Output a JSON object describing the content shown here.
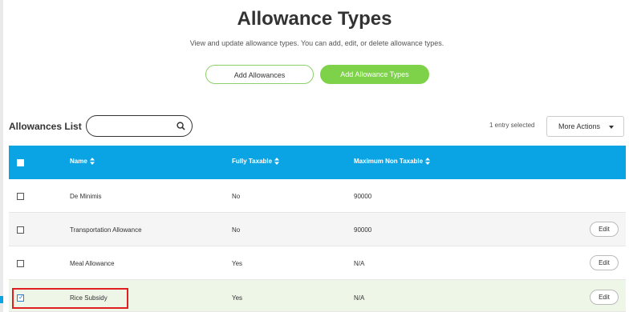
{
  "header": {
    "title": "Allowance Types",
    "subtitle": "View and update allowance types. You can add, edit, or delete allowance types."
  },
  "actions": {
    "add_allowances_label": "Add Allowances",
    "add_allowance_types_label": "Add Allowance Types"
  },
  "list": {
    "title": "Allowances List",
    "search_placeholder": "",
    "selected_count_text": "1 entry selected",
    "more_actions_label": "More Actions"
  },
  "table": {
    "columns": [
      "Name",
      "Fully Taxable",
      "Maximum Non Taxable"
    ],
    "rows": [
      {
        "name": "De Minimis",
        "fully_taxable": "No",
        "max_non_taxable": "90000",
        "checked": false,
        "edit_label": ""
      },
      {
        "name": "Transportation Allowance",
        "fully_taxable": "No",
        "max_non_taxable": "90000",
        "checked": false,
        "edit_label": "Edit"
      },
      {
        "name": "Meal Allowance",
        "fully_taxable": "Yes",
        "max_non_taxable": "N/A",
        "checked": false,
        "edit_label": "Edit"
      },
      {
        "name": "Rice Subsidy",
        "fully_taxable": "Yes",
        "max_non_taxable": "N/A",
        "checked": true,
        "edit_label": "Edit"
      }
    ]
  },
  "colors": {
    "header_blue": "#0aa4e5",
    "accent_green": "#7ed24a",
    "highlight_red": "#e02020"
  }
}
